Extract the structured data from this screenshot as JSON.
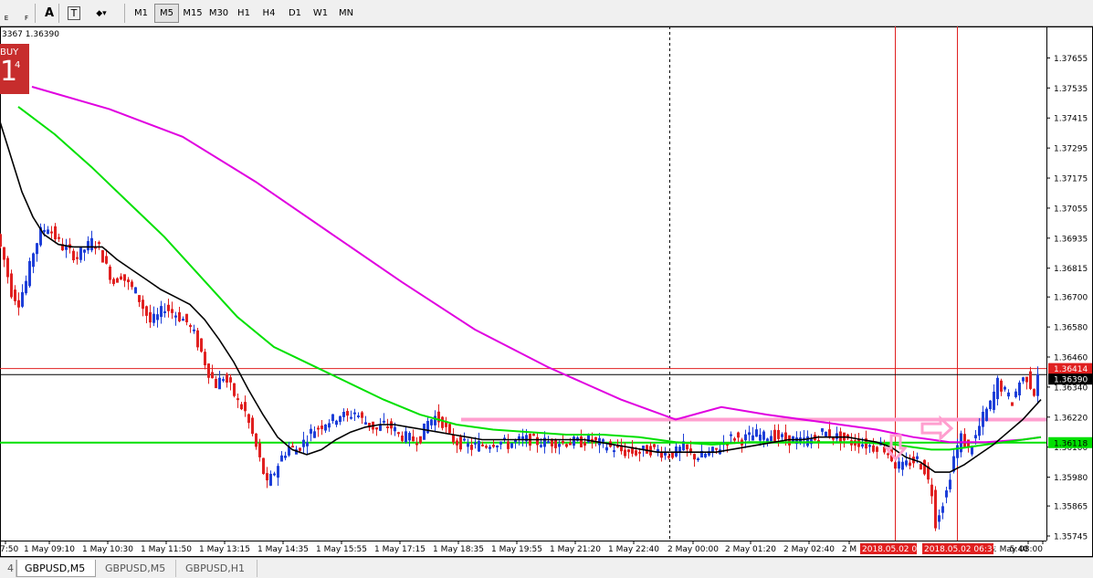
{
  "toolbar": {
    "icon_buttons": [
      {
        "name": "periods-left-icon",
        "label": "E"
      },
      {
        "name": "periods-right-icon",
        "label": "F"
      },
      {
        "name": "text-tool-icon",
        "label": "A"
      },
      {
        "name": "text-label-tool-icon",
        "label": "T"
      },
      {
        "name": "arrows-tool-icon",
        "label": "◆▾"
      }
    ],
    "timeframes": [
      "M1",
      "M5",
      "M15",
      "M30",
      "H1",
      "H4",
      "D1",
      "W1",
      "MN"
    ],
    "active_timeframe": "M5"
  },
  "status_text": "3367 1.36390",
  "buy_panel": {
    "label": "BUY",
    "big": "1",
    "sup": "4"
  },
  "tabs": [
    {
      "label": "4",
      "active": false
    },
    {
      "label": "GBPUSD,M5",
      "active": true
    },
    {
      "label": "GBPUSD,M5",
      "active": false
    },
    {
      "label": "GBPUSD,H1",
      "active": false
    }
  ],
  "colors": {
    "background": "#ffffff",
    "bull_candle": "#1e3fd8",
    "bear_candle": "#e02020",
    "ma_black": "#000000",
    "ma_green": "#00e000",
    "ma_magenta": "#e000e0",
    "horizontal_green": "#00e000",
    "horizontal_pink": "#ff9fcf",
    "vertical_red": "#e02020",
    "price_line_red": "#e02020",
    "bid_line": "#000000"
  },
  "chart_data": {
    "type": "candlestick",
    "symbol": "GBPUSD,M5",
    "ylim": [
      1.35745,
      1.37715
    ],
    "price_labels": [
      "1.37655",
      "1.37535",
      "1.37415",
      "1.37295",
      "1.37175",
      "1.37055",
      "1.36935",
      "1.36815",
      "1.36700",
      "1.36580",
      "1.36460",
      "1.36340",
      "1.36220",
      "1.36100",
      "1.35980",
      "1.35865",
      "1.35745"
    ],
    "time_labels": [
      "7:50",
      "1 May 09:10",
      "1 May 10:30",
      "1 May 11:50",
      "1 May 13:15",
      "1 May 14:35",
      "1 May 15:55",
      "1 May 17:15",
      "1 May 18:35",
      "1 May 19:55",
      "1 May 21:20",
      "1 May 22:40",
      "2 May 00:00",
      "2 May 01:20",
      "2 May 02:40",
      "2 M",
      "5:40",
      "2 May 08:00"
    ],
    "current_bid": "1.36390",
    "current_ask_line": "1.36414",
    "green_level": "1.36118",
    "red_time_labels": [
      "2018.05.02 05:",
      "2018.05.02 06:37"
    ],
    "close_path": [
      [
        0,
        1.3695
      ],
      [
        8,
        1.3685
      ],
      [
        16,
        1.3672
      ],
      [
        24,
        1.3668
      ],
      [
        32,
        1.3676
      ],
      [
        40,
        1.3688
      ],
      [
        48,
        1.3696
      ],
      [
        56,
        1.3698
      ],
      [
        64,
        1.3694
      ],
      [
        72,
        1.369
      ],
      [
        80,
        1.3688
      ],
      [
        88,
        1.3686
      ],
      [
        96,
        1.3689
      ],
      [
        104,
        1.3692
      ],
      [
        112,
        1.369
      ],
      [
        120,
        1.3682
      ],
      [
        128,
        1.3676
      ],
      [
        136,
        1.3679
      ],
      [
        144,
        1.3675
      ],
      [
        152,
        1.3672
      ],
      [
        160,
        1.3666
      ],
      [
        168,
        1.366
      ],
      [
        176,
        1.3662
      ],
      [
        184,
        1.3666
      ],
      [
        192,
        1.3664
      ],
      [
        200,
        1.3662
      ],
      [
        208,
        1.366
      ],
      [
        216,
        1.3655
      ],
      [
        224,
        1.3648
      ],
      [
        232,
        1.364
      ],
      [
        240,
        1.3635
      ],
      [
        248,
        1.3638
      ],
      [
        256,
        1.3634
      ],
      [
        264,
        1.3628
      ],
      [
        272,
        1.3624
      ],
      [
        280,
        1.3615
      ],
      [
        288,
        1.3605
      ],
      [
        296,
        1.3595
      ],
      [
        304,
        1.36
      ],
      [
        312,
        1.3606
      ],
      [
        320,
        1.361
      ],
      [
        328,
        1.3609
      ],
      [
        336,
        1.3612
      ],
      [
        344,
        1.3616
      ],
      [
        352,
        1.3618
      ],
      [
        360,
        1.362
      ],
      [
        368,
        1.3621
      ],
      [
        376,
        1.3623
      ],
      [
        384,
        1.3622
      ],
      [
        392,
        1.3624
      ],
      [
        400,
        1.3621
      ],
      [
        408,
        1.3619
      ],
      [
        416,
        1.3617
      ],
      [
        424,
        1.3619
      ],
      [
        432,
        1.3618
      ],
      [
        440,
        1.3615
      ],
      [
        448,
        1.3614
      ],
      [
        456,
        1.3613
      ],
      [
        464,
        1.3614
      ],
      [
        472,
        1.362
      ],
      [
        480,
        1.3622
      ],
      [
        488,
        1.362
      ],
      [
        496,
        1.3614
      ],
      [
        504,
        1.3612
      ],
      [
        512,
        1.3611
      ],
      [
        520,
        1.361
      ],
      [
        528,
        1.3611
      ],
      [
        536,
        1.3611
      ],
      [
        544,
        1.3612
      ],
      [
        552,
        1.3612
      ],
      [
        560,
        1.3611
      ],
      [
        568,
        1.3612
      ],
      [
        576,
        1.3613
      ],
      [
        584,
        1.3613
      ],
      [
        592,
        1.3612
      ],
      [
        600,
        1.3612
      ],
      [
        608,
        1.3612
      ],
      [
        616,
        1.3612
      ],
      [
        624,
        1.3612
      ],
      [
        632,
        1.3612
      ],
      [
        640,
        1.3612
      ],
      [
        648,
        1.3613
      ],
      [
        656,
        1.3612
      ],
      [
        664,
        1.3611
      ],
      [
        672,
        1.361
      ],
      [
        680,
        1.3609
      ],
      [
        688,
        1.3608
      ],
      [
        696,
        1.3608
      ],
      [
        704,
        1.3608
      ],
      [
        712,
        1.3609
      ],
      [
        720,
        1.3609
      ],
      [
        728,
        1.3608
      ],
      [
        736,
        1.3607
      ],
      [
        744,
        1.3608
      ],
      [
        752,
        1.361
      ],
      [
        760,
        1.3607
      ],
      [
        768,
        1.3606
      ],
      [
        776,
        1.3607
      ],
      [
        784,
        1.3608
      ],
      [
        792,
        1.361
      ],
      [
        800,
        1.3613
      ],
      [
        808,
        1.3614
      ],
      [
        816,
        1.3613
      ],
      [
        824,
        1.3614
      ],
      [
        832,
        1.3615
      ],
      [
        840,
        1.3614
      ],
      [
        848,
        1.3615
      ],
      [
        856,
        1.3614
      ],
      [
        864,
        1.3613
      ],
      [
        872,
        1.3613
      ],
      [
        880,
        1.3612
      ],
      [
        888,
        1.3613
      ],
      [
        896,
        1.3613
      ],
      [
        904,
        1.3616
      ],
      [
        912,
        1.3615
      ],
      [
        920,
        1.3614
      ],
      [
        928,
        1.3613
      ],
      [
        936,
        1.3612
      ],
      [
        944,
        1.3612
      ],
      [
        952,
        1.3611
      ],
      [
        960,
        1.361
      ],
      [
        968,
        1.3611
      ],
      [
        976,
        1.3608
      ],
      [
        984,
        1.3603
      ],
      [
        992,
        1.3602
      ],
      [
        1000,
        1.3604
      ],
      [
        1008,
        1.3605
      ],
      [
        1016,
        1.3601
      ],
      [
        1024,
        1.3592
      ],
      [
        1028,
        1.358
      ],
      [
        1032,
        1.3584
      ],
      [
        1040,
        1.3592
      ],
      [
        1048,
        1.3606
      ],
      [
        1056,
        1.3614
      ],
      [
        1064,
        1.3609
      ],
      [
        1072,
        1.3614
      ],
      [
        1080,
        1.3622
      ],
      [
        1088,
        1.3627
      ],
      [
        1096,
        1.3636
      ],
      [
        1104,
        1.3632
      ],
      [
        1112,
        1.3628
      ],
      [
        1120,
        1.3636
      ],
      [
        1128,
        1.3638
      ],
      [
        1136,
        1.3632
      ],
      [
        1140,
        1.364
      ]
    ],
    "ma_black": [
      [
        0,
        1.374
      ],
      [
        12,
        1.3726
      ],
      [
        24,
        1.3712
      ],
      [
        36,
        1.3702
      ],
      [
        48,
        1.3695
      ],
      [
        64,
        1.3691
      ],
      [
        80,
        1.369
      ],
      [
        96,
        1.369
      ],
      [
        112,
        1.369
      ],
      [
        128,
        1.3685
      ],
      [
        144,
        1.3681
      ],
      [
        160,
        1.3677
      ],
      [
        176,
        1.3673
      ],
      [
        192,
        1.367
      ],
      [
        208,
        1.3667
      ],
      [
        224,
        1.3661
      ],
      [
        240,
        1.3653
      ],
      [
        256,
        1.3644
      ],
      [
        272,
        1.3633
      ],
      [
        288,
        1.3623
      ],
      [
        304,
        1.3614
      ],
      [
        320,
        1.3609
      ],
      [
        336,
        1.3607
      ],
      [
        352,
        1.3609
      ],
      [
        368,
        1.3613
      ],
      [
        384,
        1.3616
      ],
      [
        400,
        1.3618
      ],
      [
        416,
        1.3619
      ],
      [
        432,
        1.3619
      ],
      [
        448,
        1.3618
      ],
      [
        464,
        1.3617
      ],
      [
        480,
        1.3616
      ],
      [
        496,
        1.3615
      ],
      [
        512,
        1.3614
      ],
      [
        528,
        1.3613
      ],
      [
        544,
        1.3613
      ],
      [
        560,
        1.3613
      ],
      [
        576,
        1.3613
      ],
      [
        592,
        1.3613
      ],
      [
        608,
        1.3613
      ],
      [
        624,
        1.3613
      ],
      [
        640,
        1.3613
      ],
      [
        656,
        1.3612
      ],
      [
        672,
        1.3611
      ],
      [
        688,
        1.361
      ],
      [
        704,
        1.3609
      ],
      [
        720,
        1.3608
      ],
      [
        736,
        1.3608
      ],
      [
        752,
        1.3608
      ],
      [
        768,
        1.3608
      ],
      [
        784,
        1.3608
      ],
      [
        800,
        1.3609
      ],
      [
        816,
        1.361
      ],
      [
        832,
        1.3611
      ],
      [
        848,
        1.3612
      ],
      [
        864,
        1.3613
      ],
      [
        880,
        1.3613
      ],
      [
        896,
        1.3614
      ],
      [
        912,
        1.3614
      ],
      [
        928,
        1.3614
      ],
      [
        944,
        1.3613
      ],
      [
        960,
        1.3612
      ],
      [
        976,
        1.361
      ],
      [
        992,
        1.3606
      ],
      [
        1008,
        1.3604
      ],
      [
        1024,
        1.36
      ],
      [
        1040,
        1.36
      ],
      [
        1056,
        1.3603
      ],
      [
        1072,
        1.3607
      ],
      [
        1088,
        1.3611
      ],
      [
        1104,
        1.3616
      ],
      [
        1120,
        1.3621
      ],
      [
        1140,
        1.3629
      ]
    ],
    "ma_green": [
      [
        20,
        1.3746
      ],
      [
        60,
        1.3735
      ],
      [
        100,
        1.3722
      ],
      [
        140,
        1.3708
      ],
      [
        180,
        1.3694
      ],
      [
        220,
        1.3678
      ],
      [
        260,
        1.3662
      ],
      [
        300,
        1.365
      ],
      [
        340,
        1.3643
      ],
      [
        380,
        1.3636
      ],
      [
        420,
        1.3629
      ],
      [
        460,
        1.3623
      ],
      [
        500,
        1.3619
      ],
      [
        540,
        1.3617
      ],
      [
        580,
        1.3616
      ],
      [
        620,
        1.3615
      ],
      [
        660,
        1.3615
      ],
      [
        700,
        1.3614
      ],
      [
        740,
        1.3612
      ],
      [
        780,
        1.3611
      ],
      [
        820,
        1.3612
      ],
      [
        860,
        1.3612
      ],
      [
        900,
        1.3612
      ],
      [
        940,
        1.3612
      ],
      [
        980,
        1.3611
      ],
      [
        1000,
        1.361
      ],
      [
        1020,
        1.3609
      ],
      [
        1040,
        1.3609
      ],
      [
        1060,
        1.361
      ],
      [
        1080,
        1.3611
      ],
      [
        1100,
        1.3612
      ],
      [
        1120,
        1.3613
      ],
      [
        1140,
        1.3614
      ]
    ],
    "ma_magenta": [
      [
        35,
        1.3754
      ],
      [
        120,
        1.3745
      ],
      [
        200,
        1.3734
      ],
      [
        280,
        1.3716
      ],
      [
        360,
        1.3696
      ],
      [
        440,
        1.3676
      ],
      [
        520,
        1.3657
      ],
      [
        600,
        1.3642
      ],
      [
        680,
        1.3629
      ],
      [
        740,
        1.3621
      ],
      [
        790,
        1.3626
      ],
      [
        840,
        1.3623
      ],
      [
        900,
        1.362
      ],
      [
        960,
        1.3617
      ],
      [
        1000,
        1.3614
      ],
      [
        1040,
        1.3612
      ],
      [
        1080,
        1.3612
      ],
      [
        1120,
        1.3613
      ],
      [
        1140,
        1.3614
      ]
    ]
  }
}
